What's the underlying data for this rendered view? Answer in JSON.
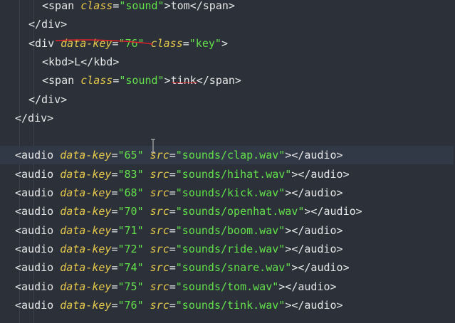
{
  "lines": [
    {
      "indent": 2,
      "parts": [
        {
          "c": "t",
          "v": "<span "
        },
        {
          "c": "at",
          "v": "class"
        },
        {
          "c": "eq",
          "v": "="
        },
        {
          "c": "st",
          "v": "\"sound\""
        },
        {
          "c": "t",
          "v": ">tom</span>"
        }
      ]
    },
    {
      "indent": 1,
      "parts": [
        {
          "c": "t",
          "v": "</div>"
        }
      ]
    },
    {
      "indent": 1,
      "parts": [
        {
          "c": "t",
          "v": "<div "
        },
        {
          "c": "at",
          "v": "data-key"
        },
        {
          "c": "eq",
          "v": "="
        },
        {
          "c": "st",
          "v": "\"76\""
        },
        {
          "c": "t",
          "v": " "
        },
        {
          "c": "at",
          "v": "class"
        },
        {
          "c": "eq",
          "v": "="
        },
        {
          "c": "st",
          "v": "\"key\""
        },
        {
          "c": "t",
          "v": ">"
        }
      ]
    },
    {
      "indent": 2,
      "parts": [
        {
          "c": "t",
          "v": "<kbd>L</kbd>"
        }
      ]
    },
    {
      "indent": 2,
      "parts": [
        {
          "c": "t",
          "v": "<span "
        },
        {
          "c": "at",
          "v": "class"
        },
        {
          "c": "eq",
          "v": "="
        },
        {
          "c": "st",
          "v": "\"sound\""
        },
        {
          "c": "t",
          "v": ">tink</span>"
        }
      ]
    },
    {
      "indent": 1,
      "parts": [
        {
          "c": "t",
          "v": "</div>"
        }
      ]
    },
    {
      "indent": 0,
      "parts": [
        {
          "c": "t",
          "v": "</div>"
        }
      ]
    },
    {
      "indent": 0,
      "parts": []
    },
    {
      "indent": 0,
      "hl": true,
      "parts": [
        {
          "c": "t",
          "v": "<audio "
        },
        {
          "c": "at",
          "v": "data-key"
        },
        {
          "c": "eq",
          "v": "="
        },
        {
          "c": "st",
          "v": "\"65\""
        },
        {
          "c": "t",
          "v": " "
        },
        {
          "c": "at",
          "v": "src"
        },
        {
          "c": "eq",
          "v": "="
        },
        {
          "c": "st",
          "v": "\"sounds/clap.wav\""
        },
        {
          "c": "t",
          "v": "></audio>"
        }
      ]
    },
    {
      "indent": 0,
      "parts": [
        {
          "c": "t",
          "v": "<audio "
        },
        {
          "c": "at",
          "v": "data-key"
        },
        {
          "c": "eq",
          "v": "="
        },
        {
          "c": "st",
          "v": "\"83\""
        },
        {
          "c": "t",
          "v": " "
        },
        {
          "c": "at",
          "v": "src"
        },
        {
          "c": "eq",
          "v": "="
        },
        {
          "c": "st",
          "v": "\"sounds/hihat.wav\""
        },
        {
          "c": "t",
          "v": "></audio>"
        }
      ]
    },
    {
      "indent": 0,
      "parts": [
        {
          "c": "t",
          "v": "<audio "
        },
        {
          "c": "at",
          "v": "data-key"
        },
        {
          "c": "eq",
          "v": "="
        },
        {
          "c": "st",
          "v": "\"68\""
        },
        {
          "c": "t",
          "v": " "
        },
        {
          "c": "at",
          "v": "src"
        },
        {
          "c": "eq",
          "v": "="
        },
        {
          "c": "st",
          "v": "\"sounds/kick.wav\""
        },
        {
          "c": "t",
          "v": "></audio>"
        }
      ]
    },
    {
      "indent": 0,
      "parts": [
        {
          "c": "t",
          "v": "<audio "
        },
        {
          "c": "at",
          "v": "data-key"
        },
        {
          "c": "eq",
          "v": "="
        },
        {
          "c": "st",
          "v": "\"70\""
        },
        {
          "c": "t",
          "v": " "
        },
        {
          "c": "at",
          "v": "src"
        },
        {
          "c": "eq",
          "v": "="
        },
        {
          "c": "st",
          "v": "\"sounds/openhat.wav\""
        },
        {
          "c": "t",
          "v": "></audio>"
        }
      ]
    },
    {
      "indent": 0,
      "parts": [
        {
          "c": "t",
          "v": "<audio "
        },
        {
          "c": "at",
          "v": "data-key"
        },
        {
          "c": "eq",
          "v": "="
        },
        {
          "c": "st",
          "v": "\"71\""
        },
        {
          "c": "t",
          "v": " "
        },
        {
          "c": "at",
          "v": "src"
        },
        {
          "c": "eq",
          "v": "="
        },
        {
          "c": "st",
          "v": "\"sounds/boom.wav\""
        },
        {
          "c": "t",
          "v": "></audio>"
        }
      ]
    },
    {
      "indent": 0,
      "parts": [
        {
          "c": "t",
          "v": "<audio "
        },
        {
          "c": "at",
          "v": "data-key"
        },
        {
          "c": "eq",
          "v": "="
        },
        {
          "c": "st",
          "v": "\"72\""
        },
        {
          "c": "t",
          "v": " "
        },
        {
          "c": "at",
          "v": "src"
        },
        {
          "c": "eq",
          "v": "="
        },
        {
          "c": "st",
          "v": "\"sounds/ride.wav\""
        },
        {
          "c": "t",
          "v": "></audio>"
        }
      ]
    },
    {
      "indent": 0,
      "parts": [
        {
          "c": "t",
          "v": "<audio "
        },
        {
          "c": "at",
          "v": "data-key"
        },
        {
          "c": "eq",
          "v": "="
        },
        {
          "c": "st",
          "v": "\"74\""
        },
        {
          "c": "t",
          "v": " "
        },
        {
          "c": "at",
          "v": "src"
        },
        {
          "c": "eq",
          "v": "="
        },
        {
          "c": "st",
          "v": "\"sounds/snare.wav\""
        },
        {
          "c": "t",
          "v": "></audio>"
        }
      ]
    },
    {
      "indent": 0,
      "parts": [
        {
          "c": "t",
          "v": "<audio "
        },
        {
          "c": "at",
          "v": "data-key"
        },
        {
          "c": "eq",
          "v": "="
        },
        {
          "c": "st",
          "v": "\"75\""
        },
        {
          "c": "t",
          "v": " "
        },
        {
          "c": "at",
          "v": "src"
        },
        {
          "c": "eq",
          "v": "="
        },
        {
          "c": "st",
          "v": "\"sounds/tom.wav\""
        },
        {
          "c": "t",
          "v": "></audio>"
        }
      ]
    },
    {
      "indent": 0,
      "parts": [
        {
          "c": "t",
          "v": "<audio "
        },
        {
          "c": "at",
          "v": "data-key"
        },
        {
          "c": "eq",
          "v": "="
        },
        {
          "c": "st",
          "v": "\"76\""
        },
        {
          "c": "t",
          "v": " "
        },
        {
          "c": "at",
          "v": "src"
        },
        {
          "c": "eq",
          "v": "="
        },
        {
          "c": "st",
          "v": "\"sounds/tink.wav\""
        },
        {
          "c": "t",
          "v": "></audio>"
        }
      ]
    }
  ],
  "colors": {
    "background": "#2b3039",
    "highlight_line": "#323946",
    "text": "#e6e6e6",
    "attribute": "#e6c84b",
    "string": "#63e14a",
    "annotation": "#e0222a"
  }
}
